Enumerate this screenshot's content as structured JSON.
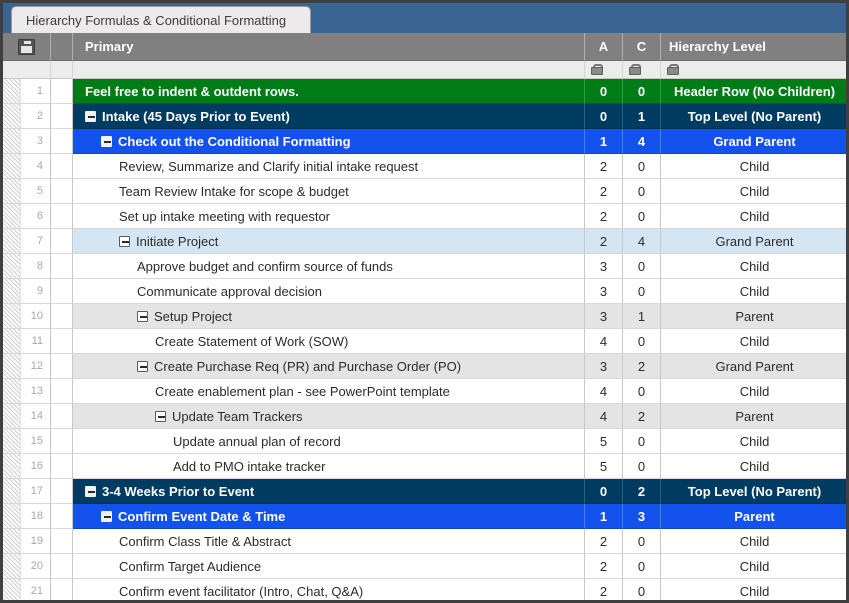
{
  "window": {
    "tab_label": "Hierarchy Formulas & Conditional Formatting"
  },
  "header": {
    "gutter_icon": "save-icon",
    "primary_label": "Primary",
    "col_a_label": "A",
    "col_c_label": "C",
    "hierarchy_label": "Hierarchy Level",
    "lock_icon": "lock-icon"
  },
  "rows": [
    {
      "num": "1",
      "text": "Feel free to indent & outdent rows.",
      "indent": 0,
      "toggle": false,
      "a": "0",
      "c": "0",
      "hierarchy": "Header Row (No Children)",
      "style": "v-green"
    },
    {
      "num": "2",
      "text": "Intake (45 Days Prior to Event)",
      "indent": 0,
      "toggle": true,
      "a": "0",
      "c": "1",
      "hierarchy": "Top Level (No Parent)",
      "style": "v-navy"
    },
    {
      "num": "3",
      "text": "Check out the Conditional Formatting",
      "indent": 1,
      "toggle": true,
      "a": "1",
      "c": "4",
      "hierarchy": "Grand Parent",
      "style": "v-blue"
    },
    {
      "num": "4",
      "text": "Review, Summarize and Clarify initial intake request",
      "indent": 2,
      "toggle": false,
      "a": "2",
      "c": "0",
      "hierarchy": "Child",
      "style": "v-white"
    },
    {
      "num": "5",
      "text": "Team Review Intake for scope & budget",
      "indent": 2,
      "toggle": false,
      "a": "2",
      "c": "0",
      "hierarchy": "Child",
      "style": "v-white"
    },
    {
      "num": "6",
      "text": "Set up intake meeting with requestor",
      "indent": 2,
      "toggle": false,
      "a": "2",
      "c": "0",
      "hierarchy": "Child",
      "style": "v-white"
    },
    {
      "num": "7",
      "text": "Initiate Project",
      "indent": 2,
      "toggle": true,
      "a": "2",
      "c": "4",
      "hierarchy": "Grand Parent",
      "style": "v-lblue"
    },
    {
      "num": "8",
      "text": "Approve budget and confirm source of funds",
      "indent": 3,
      "toggle": false,
      "a": "3",
      "c": "0",
      "hierarchy": "Child",
      "style": "v-white"
    },
    {
      "num": "9",
      "text": "Communicate approval decision",
      "indent": 3,
      "toggle": false,
      "a": "3",
      "c": "0",
      "hierarchy": "Child",
      "style": "v-white"
    },
    {
      "num": "10",
      "text": "Setup Project",
      "indent": 3,
      "toggle": true,
      "a": "3",
      "c": "1",
      "hierarchy": "Parent",
      "style": "v-gray"
    },
    {
      "num": "11",
      "text": "Create Statement of Work (SOW)",
      "indent": 4,
      "toggle": false,
      "a": "4",
      "c": "0",
      "hierarchy": "Child",
      "style": "v-white"
    },
    {
      "num": "12",
      "text": "Create Purchase Req (PR) and Purchase Order (PO)",
      "indent": 3,
      "toggle": true,
      "a": "3",
      "c": "2",
      "hierarchy": "Grand Parent",
      "style": "v-gray"
    },
    {
      "num": "13",
      "text": "Create enablement plan - see PowerPoint template",
      "indent": 4,
      "toggle": false,
      "a": "4",
      "c": "0",
      "hierarchy": "Child",
      "style": "v-white"
    },
    {
      "num": "14",
      "text": "Update Team Trackers",
      "indent": 4,
      "toggle": true,
      "a": "4",
      "c": "2",
      "hierarchy": "Parent",
      "style": "v-gray"
    },
    {
      "num": "15",
      "text": "Update annual plan of record",
      "indent": 5,
      "toggle": false,
      "a": "5",
      "c": "0",
      "hierarchy": "Child",
      "style": "v-white"
    },
    {
      "num": "16",
      "text": "Add to PMO intake tracker",
      "indent": 5,
      "toggle": false,
      "a": "5",
      "c": "0",
      "hierarchy": "Child",
      "style": "v-white"
    },
    {
      "num": "17",
      "text": "3-4 Weeks Prior to Event",
      "indent": 0,
      "toggle": true,
      "a": "0",
      "c": "2",
      "hierarchy": "Top Level (No Parent)",
      "style": "v-navy"
    },
    {
      "num": "18",
      "text": "Confirm Event Date & Time",
      "indent": 1,
      "toggle": true,
      "a": "1",
      "c": "3",
      "hierarchy": "Parent",
      "style": "v-blue"
    },
    {
      "num": "19",
      "text": "Confirm Class Title & Abstract",
      "indent": 2,
      "toggle": false,
      "a": "2",
      "c": "0",
      "hierarchy": "Child",
      "style": "v-white"
    },
    {
      "num": "20",
      "text": "Confirm Target Audience",
      "indent": 2,
      "toggle": false,
      "a": "2",
      "c": "0",
      "hierarchy": "Child",
      "style": "v-white"
    },
    {
      "num": "21",
      "text": "Confirm event facilitator (Intro, Chat, Q&A)",
      "indent": 2,
      "toggle": false,
      "a": "2",
      "c": "0",
      "hierarchy": "Child",
      "style": "v-white"
    }
  ],
  "colors": {
    "tabbar": "#3a6593",
    "header": "#808080",
    "green": "#007c16",
    "navy": "#003b62",
    "blue": "#1352ec",
    "light_blue": "#d4e6f4",
    "gray": "#e4e4e4"
  }
}
